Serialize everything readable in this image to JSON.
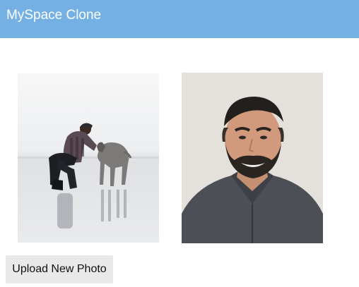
{
  "app": {
    "title": "MySpace Clone",
    "header_color": "#74b0e4"
  },
  "photos": [
    {
      "subject": "person-with-dog-on-beach"
    },
    {
      "subject": "smiling-man-portrait"
    }
  ],
  "actions": {
    "upload_label": "Upload New Photo"
  }
}
